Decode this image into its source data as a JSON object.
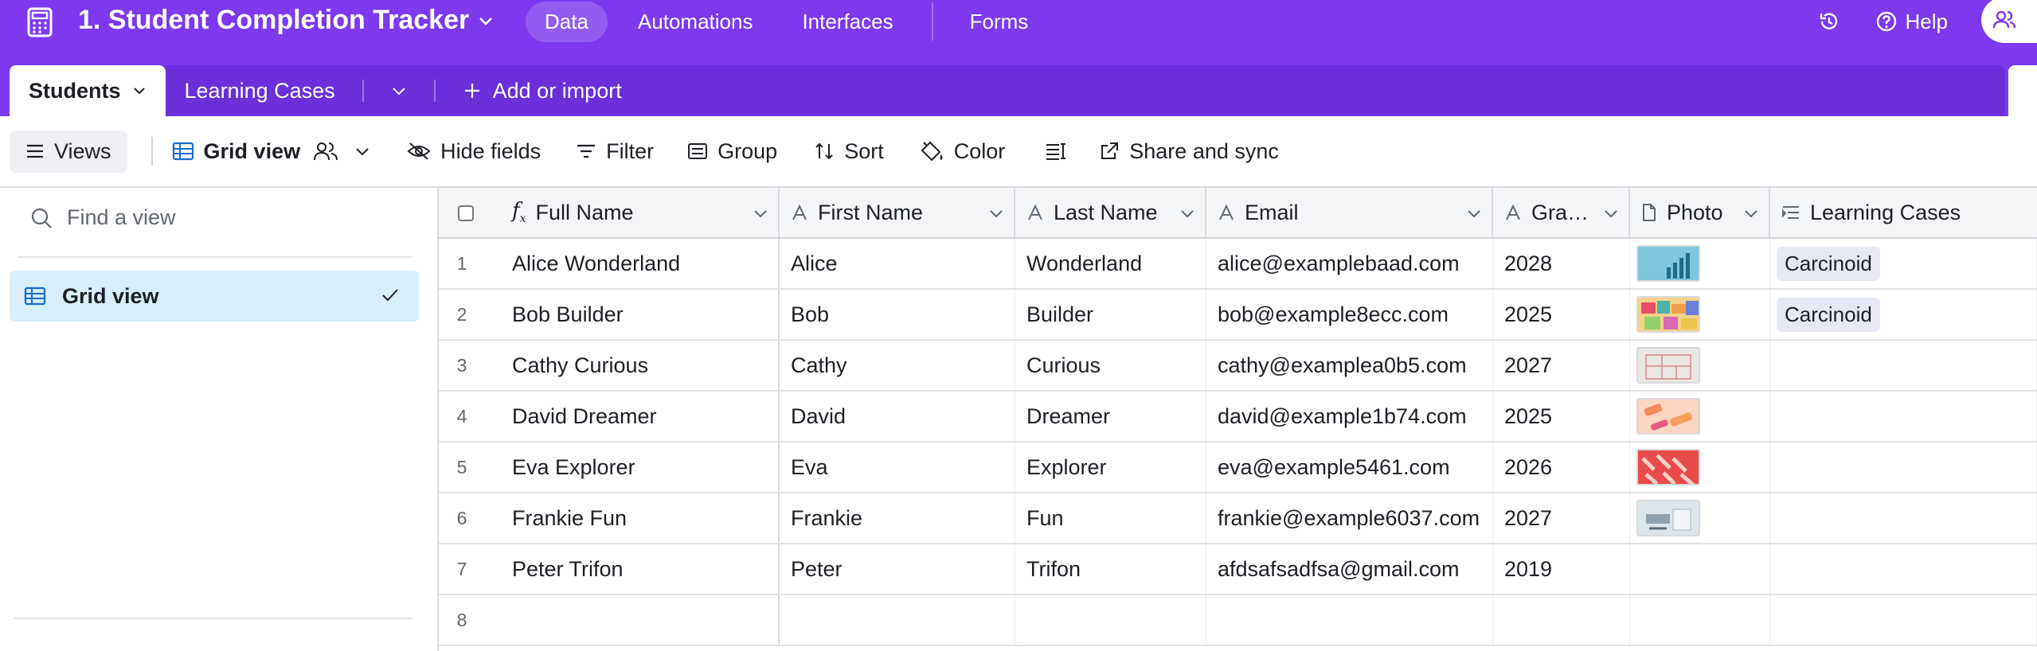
{
  "app": {
    "title": "1. Student Completion Tracker",
    "nav": [
      "Data",
      "Automations",
      "Interfaces",
      "Forms"
    ],
    "help_label": "Help",
    "accent": "#7c39ed"
  },
  "tables": {
    "tabs": [
      {
        "label": "Students",
        "active": true
      },
      {
        "label": "Learning Cases",
        "active": false
      }
    ],
    "add_label": "Add or import"
  },
  "toolbar": {
    "views_label": "Views",
    "gridview_label": "Grid view",
    "hide_fields": "Hide fields",
    "filter": "Filter",
    "group": "Group",
    "sort": "Sort",
    "color": "Color",
    "share_sync": "Share and sync"
  },
  "sidebar": {
    "search_placeholder": "Find a view",
    "views": [
      {
        "label": "Grid view",
        "selected": true
      }
    ]
  },
  "grid": {
    "columns": [
      {
        "label": "Full Name",
        "icon": "formula-icon"
      },
      {
        "label": "First Name",
        "icon": "text-icon"
      },
      {
        "label": "Last Name",
        "icon": "text-icon"
      },
      {
        "label": "Email",
        "icon": "text-icon"
      },
      {
        "label": "Gra…",
        "icon": "text-icon"
      },
      {
        "label": "Photo",
        "icon": "attachment-icon"
      },
      {
        "label": "Learning Cases",
        "icon": "link-icon"
      }
    ],
    "rows": [
      {
        "n": "1",
        "full": "Alice Wonderland",
        "first": "Alice",
        "last": "Wonderland",
        "email": "alice@examplebaad.com",
        "grad": "2028",
        "photo": "chart-thumbnail",
        "cases": "Carcinoid"
      },
      {
        "n": "2",
        "full": "Bob Builder",
        "first": "Bob",
        "last": "Builder",
        "email": "bob@example8ecc.com",
        "grad": "2025",
        "photo": "blocks-thumbnail",
        "cases": "Carcinoid"
      },
      {
        "n": "3",
        "full": "Cathy Curious",
        "first": "Cathy",
        "last": "Curious",
        "email": "cathy@examplea0b5.com",
        "grad": "2027",
        "photo": "plan-thumbnail",
        "cases": ""
      },
      {
        "n": "4",
        "full": "David Dreamer",
        "first": "David",
        "last": "Dreamer",
        "email": "david@example1b74.com",
        "grad": "2025",
        "photo": "orange-shapes-thumbnail",
        "cases": ""
      },
      {
        "n": "5",
        "full": "Eva Explorer",
        "first": "Eva",
        "last": "Explorer",
        "email": "eva@example5461.com",
        "grad": "2026",
        "photo": "red-pattern-thumbnail",
        "cases": ""
      },
      {
        "n": "6",
        "full": "Frankie Fun",
        "first": "Frankie",
        "last": "Fun",
        "email": "frankie@example6037.com",
        "grad": "2027",
        "photo": "tools-thumbnail",
        "cases": ""
      },
      {
        "n": "7",
        "full": "Peter Trifon",
        "first": "Peter",
        "last": "Trifon",
        "email": "afdsafsadfsa@gmail.com",
        "grad": "2019",
        "photo": "",
        "cases": ""
      },
      {
        "n": "8",
        "full": "",
        "first": "",
        "last": "",
        "email": "",
        "grad": "",
        "photo": "",
        "cases": ""
      }
    ]
  }
}
